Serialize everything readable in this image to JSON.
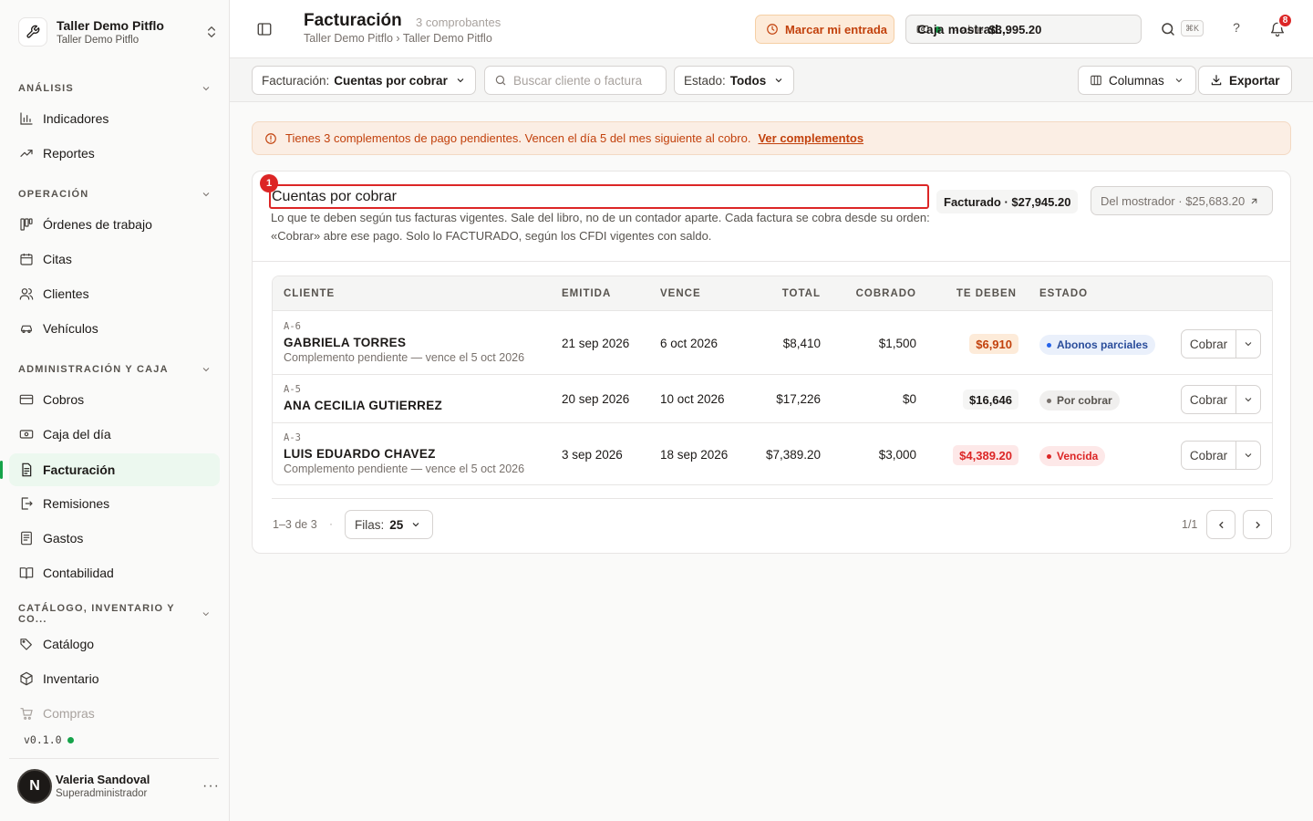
{
  "workspace": {
    "name": "Taller Demo Pitflo",
    "subtitle": "Taller Demo Pitflo"
  },
  "sidebar": {
    "sections": [
      {
        "title": "ANÁLISIS",
        "items": [
          {
            "label": "Indicadores",
            "icon": "bar-chart-icon"
          },
          {
            "label": "Reportes",
            "icon": "trend-icon"
          }
        ]
      },
      {
        "title": "OPERACIÓN",
        "items": [
          {
            "label": "Órdenes de trabajo",
            "icon": "kanban-icon"
          },
          {
            "label": "Citas",
            "icon": "calendar-icon"
          },
          {
            "label": "Clientes",
            "icon": "users-icon"
          },
          {
            "label": "Vehículos",
            "icon": "car-icon"
          }
        ]
      },
      {
        "title": "ADMINISTRACIÓN Y CAJA",
        "items": [
          {
            "label": "Cobros",
            "icon": "card-icon"
          },
          {
            "label": "Caja del día",
            "icon": "cash-icon"
          },
          {
            "label": "Facturación",
            "icon": "invoice-icon",
            "active": true
          },
          {
            "label": "Remisiones",
            "icon": "file-export-icon"
          },
          {
            "label": "Gastos",
            "icon": "receipt-icon"
          },
          {
            "label": "Contabilidad",
            "icon": "book-icon"
          }
        ]
      },
      {
        "title": "CATÁLOGO, INVENTARIO Y CO...",
        "items": [
          {
            "label": "Catálogo",
            "icon": "tags-icon"
          },
          {
            "label": "Inventario",
            "icon": "box-icon"
          },
          {
            "label": "Compras",
            "icon": "cart-icon"
          }
        ]
      }
    ],
    "version": "v0.1.0",
    "user": {
      "initial": "N",
      "name": "Valeria Sandoval",
      "role": "Superadministrador",
      "more": "···"
    }
  },
  "header": {
    "title": "Facturación",
    "count": "3 comprobantes",
    "breadcrumb": "Taller Demo Pitflo › Taller Demo Pitflo",
    "entrada_label": "Marcar mi entrada",
    "caja_name": "Caja mostrad...",
    "caja_sep": "·",
    "caja_status": "abie",
    "caja_amount": "$3,995.20",
    "kbd": "⌘K",
    "help": "?",
    "notifications": "8"
  },
  "toolbar": {
    "facturacion_label": "Facturación:",
    "facturacion_value": "Cuentas por cobrar",
    "search_placeholder": "Buscar cliente o factura",
    "estado_label": "Estado:",
    "estado_value": "Todos",
    "columnas_label": "Columnas",
    "exportar_label": "Exportar"
  },
  "alert": {
    "text": "Tienes 3 complementos de pago pendientes. Vencen el día 5 del mes siguiente al cobro.",
    "link": "Ver complementos"
  },
  "card": {
    "marker": "1",
    "title": "Cuentas por cobrar",
    "description": "Lo que te deben según tus facturas vigentes. Sale del libro, no de un contador aparte. Cada factura se cobra desde su orden: «Cobrar» abre ese pago. Solo lo FACTURADO, según los CFDI vigentes con saldo.",
    "facturado": "Facturado · $27,945.20",
    "mostrador": "Del mostrador · $25,683.20"
  },
  "table": {
    "headers": {
      "cliente": "CLIENTE",
      "emitida": "EMITIDA",
      "vence": "VENCE",
      "total": "TOTAL",
      "cobrado": "COBRADO",
      "te_deben": "TE DEBEN",
      "estado": "ESTADO"
    },
    "rows": [
      {
        "folio": "A-6",
        "cliente": "GABRIELA TORRES",
        "note": "Complemento pendiente — vence el 5 oct 2026",
        "emitida": "21 sep 2026",
        "vence": "6 oct 2026",
        "total": "$8,410",
        "cobrado": "$1,500",
        "te_deben": "$6,910",
        "estado": "Abonos parciales",
        "action": "Cobrar"
      },
      {
        "folio": "A-5",
        "cliente": "ANA CECILIA GUTIERREZ",
        "note": "",
        "emitida": "20 sep 2026",
        "vence": "10 oct 2026",
        "total": "$17,226",
        "cobrado": "$0",
        "te_deben": "$16,646",
        "estado": "Por cobrar",
        "action": "Cobrar"
      },
      {
        "folio": "A-3",
        "cliente": "LUIS EDUARDO CHAVEZ",
        "note": "Complemento pendiente — vence el 5 oct 2026",
        "emitida": "3 sep 2026",
        "vence": "18 sep 2026",
        "total": "$7,389.20",
        "cobrado": "$3,000",
        "te_deben": "$4,389.20",
        "estado": "Vencida",
        "action": "Cobrar"
      }
    ]
  },
  "pagination": {
    "range": "1–3 de 3",
    "sep": "·",
    "rows_label": "Filas:",
    "rows_value": "25",
    "page": "1/1"
  },
  "colors": {
    "accent_green": "#16a34a",
    "warning_orange": "#c2410c",
    "danger_red": "#dc2626",
    "info_blue": "#2563eb"
  }
}
